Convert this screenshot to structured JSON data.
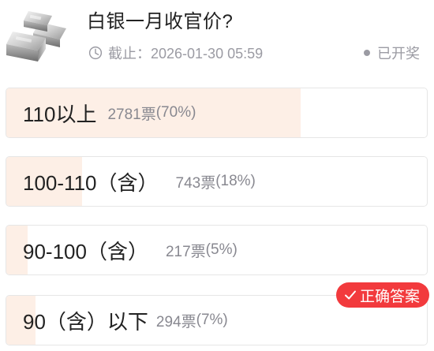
{
  "question": {
    "title": "白银一月收官价?",
    "deadline": "截止：2026-01-30 05:59",
    "status": "已开奖"
  },
  "options": [
    {
      "label": "110以上",
      "votes": "2781票",
      "percent": "(70%)",
      "fill": 0.7,
      "correct": false
    },
    {
      "label": "100-110（含）",
      "votes": "743票",
      "percent": "(18%)",
      "fill": 0.18,
      "correct": false
    },
    {
      "label": "90-100（含）",
      "votes": "217票",
      "percent": "(5%)",
      "fill": 0.05,
      "correct": false
    },
    {
      "label": "90（含）以下",
      "votes": "294票",
      "percent": "(7%)",
      "fill": 0.07,
      "correct": true
    }
  ],
  "correct_badge": "正确答案",
  "colors": {
    "fill": "#fdefe6",
    "badge": "#f23a3d",
    "muted_text": "#9b9ba3"
  },
  "icons": {
    "clock": "clock-icon",
    "check": "check-icon",
    "thumbnail": "silver-bars-image"
  }
}
